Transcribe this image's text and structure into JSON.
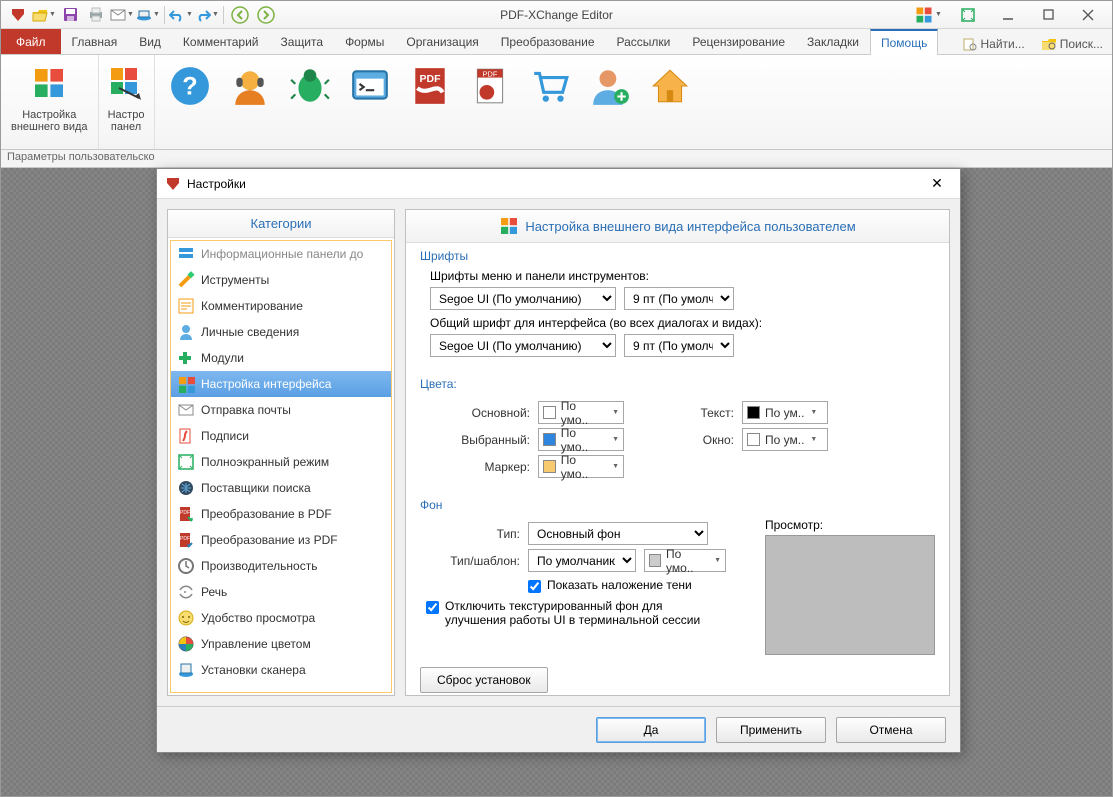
{
  "app": {
    "title": "PDF-XChange Editor"
  },
  "tabs": {
    "file": "Файл",
    "items": [
      "Главная",
      "Вид",
      "Комментарий",
      "Защита",
      "Формы",
      "Организация",
      "Преобразование",
      "Рассылки",
      "Рецензирование",
      "Закладки",
      "Помощь"
    ],
    "active": "Помощь",
    "find": "Найти...",
    "search": "Поиск..."
  },
  "ribbon": {
    "group1": {
      "label_l1": "Настройка",
      "label_l2": "внешнего вида"
    },
    "group2": {
      "label_l1": "Настро",
      "label_l2": "панел"
    }
  },
  "statusline": "Параметры пользовательско",
  "dialog": {
    "title": "Настройки",
    "categories_title": "Категории",
    "categories": [
      "Информационные панели до",
      "Иструменты",
      "Комментирование",
      "Личные сведения",
      "Модули",
      "Настройка интерфейса",
      "Отправка почты",
      "Подписи",
      "Полноэкранный режим",
      "Поставщики поиска",
      "Преобразование в PDF",
      "Преобразование из PDF",
      "Производительность",
      "Речь",
      "Удобство просмотра",
      "Управление цветом",
      "Установки сканера"
    ],
    "selected_category_index": 5,
    "panel_title": "Настройка внешнего вида интерфейса пользователем",
    "fonts": {
      "title": "Шрифты",
      "menu_label": "Шрифты меню и панели инструментов:",
      "menu_font": "Segoe UI (По умолчанию)",
      "menu_size": "9 пт (По умолч",
      "ui_label": "Общий шрифт для интерфейса (во всех диалогах и видах):",
      "ui_font": "Segoe UI (По умолчанию)",
      "ui_size": "9 пт (По умолч"
    },
    "colors": {
      "title": "Цвета:",
      "main_label": "Основной:",
      "main_val": "По умо..",
      "selected_label": "Выбранный:",
      "selected_val": "По умо..",
      "marker_label": "Маркер:",
      "marker_val": "По умо..",
      "text_label": "Текст:",
      "text_val": "По ум..",
      "window_label": "Окно:",
      "window_val": "По ум.."
    },
    "bg": {
      "title": "Фон",
      "type_label": "Тип:",
      "type_val": "Основный фон",
      "pattern_label": "Тип/шаблон:",
      "pattern_val": "По умолчанию",
      "pattern_color": "По умо..",
      "shadow_label": "Показать наложение тени",
      "preview_label": "Просмотр:",
      "disable_texture": "Отключить текстурированный фон для улучшения работы UI в терминальной сессии"
    },
    "reset": "Сброс установок",
    "ok": "Да",
    "apply": "Применить",
    "cancel": "Отмена"
  }
}
